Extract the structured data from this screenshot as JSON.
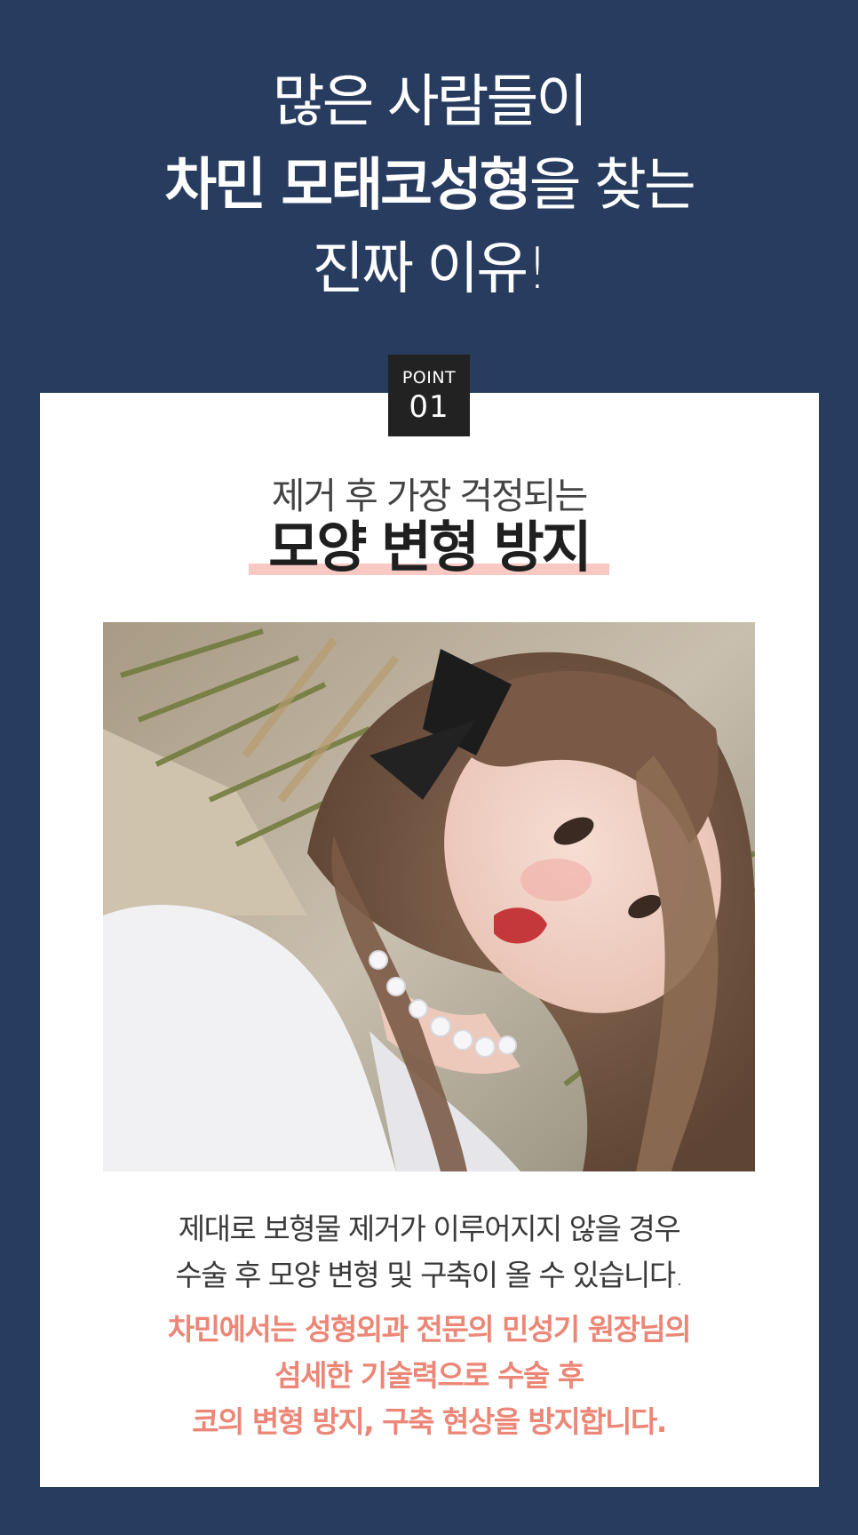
{
  "headline": {
    "line1": "많은 사람들이",
    "line2_bold": "차민 모태코성형",
    "line2_rest": "을 찾는",
    "line3": "진짜 이유!"
  },
  "point": {
    "label": "POINT",
    "number": "01"
  },
  "section": {
    "subtitle": "제거 후 가장 걱정되는",
    "title": "모양 변형 방지"
  },
  "description": [
    "제대로 보형물 제거가 이루어지지 않을 경우",
    "수술 후 모양 변형 및 구축이 올 수 있습니다."
  ],
  "emphasis": [
    "차민에서는 성형외과 전문의 민성기 원장님의",
    "섬세한 기술력으로 수술 후",
    "코의 변형 방지, 구축 현상을 방지합니다."
  ],
  "colors": {
    "background": "#273c5f",
    "card": "#ffffff",
    "badge": "#222222",
    "highlight": "#f8c8c3",
    "emphasis": "#ec8676"
  },
  "icons": {
    "photo": "portrait-photo"
  }
}
